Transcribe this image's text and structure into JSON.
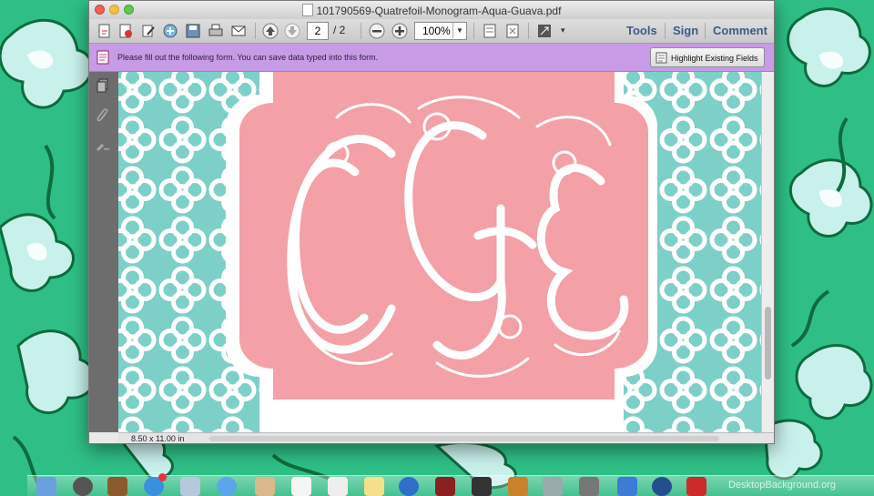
{
  "window": {
    "title": "101790569-Quatrefoil-Monogram-Aqua-Guava.pdf"
  },
  "toolbar": {
    "current_page": "2",
    "page_total": "/ 2",
    "zoom": "100%",
    "tools_label": "Tools",
    "sign_label": "Sign",
    "comment_label": "Comment"
  },
  "form_bar": {
    "message": "Please fill out the following form. You can save data typed into this form.",
    "highlight_label": "Highlight Existing Fields"
  },
  "status": {
    "page_size": "8.50 x 11.00 in"
  },
  "document": {
    "monogram": "CGE",
    "colors": {
      "aqua": "#7dd0c8",
      "guava": "#f3a0a6",
      "white": "#ffffff"
    }
  },
  "dock": {
    "watermark": "DesktopBackground.org"
  },
  "colors": {
    "desktop_green": "#2fbf86",
    "form_bar": "#c79be6",
    "toolbar_text": "#3d5a86"
  }
}
